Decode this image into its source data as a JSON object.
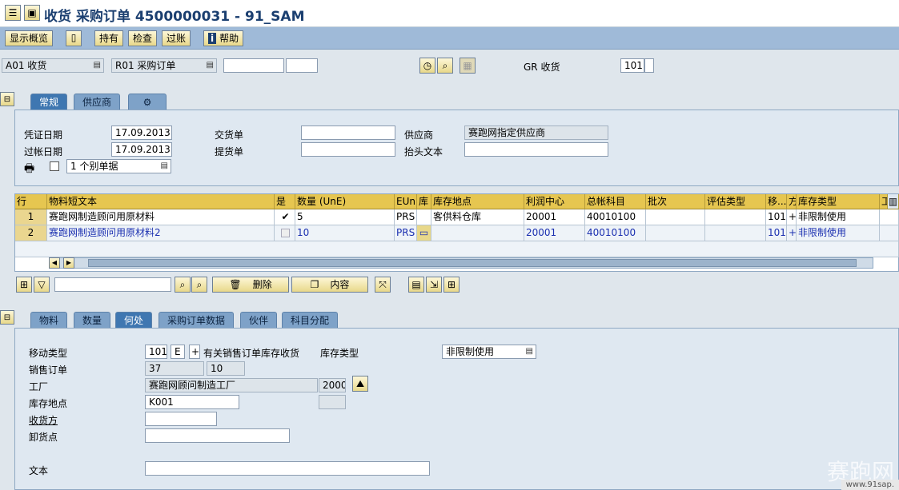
{
  "title": "收货 采购订单 4500000031 - 91_SAM",
  "toolbar": {
    "show_overview": "显示概览",
    "hold": "持有",
    "check": "检查",
    "post": "过账",
    "help": "帮助"
  },
  "header": {
    "action": "A01 收货",
    "reference": "R01 采购订单",
    "gr_label": "GR 收货",
    "movement_type": "101"
  },
  "tabs_top": [
    {
      "label": "常规",
      "active": true
    },
    {
      "label": "供应商",
      "active": false
    }
  ],
  "general": {
    "doc_date_label": "凭证日期",
    "doc_date": "17.09.2013",
    "post_date_label": "过帐日期",
    "post_date": "17.09.2013",
    "delivery_note_label": "交货单",
    "bill_of_lading_label": "提货单",
    "vendor_label": "供应商",
    "vendor": "赛跑网指定供应商",
    "header_text_label": "抬头文本",
    "slip_option": "1 个别单据"
  },
  "grid": {
    "headers": [
      "行",
      "物料短文本",
      "是",
      "数量 (UnE)",
      "EUn",
      "库",
      "库存地点",
      "利润中心",
      "总帐科目",
      "批次",
      "评估类型",
      "移...",
      "方",
      "库存类型",
      "工"
    ],
    "rows": [
      {
        "line": "1",
        "material": "赛跑网制造顾问用原材料",
        "ok": "✔",
        "qty": "5",
        "unit": "PRS",
        "sloc": "客供料仓库",
        "profit_center": "20001",
        "gl_account": "40010100",
        "mvt": "101",
        "sign": "+",
        "stock_type": "非限制使用"
      },
      {
        "line": "2",
        "material": "赛跑网制造顾问用原材料2",
        "ok": "",
        "qty": "10",
        "unit": "PRS",
        "sloc": "",
        "profit_center": "20001",
        "gl_account": "40010100",
        "mvt": "101",
        "sign": "+",
        "stock_type": "非限制使用"
      }
    ]
  },
  "grid_toolbar": {
    "delete": "删除",
    "content": "内容"
  },
  "tabs_bottom": [
    {
      "label": "物料",
      "active": false
    },
    {
      "label": "数量",
      "active": false
    },
    {
      "label": "何处",
      "active": true
    },
    {
      "label": "采购订单数据",
      "active": false
    },
    {
      "label": "伙伴",
      "active": false
    },
    {
      "label": "科目分配",
      "active": false
    }
  ],
  "where": {
    "movement_type_label": "移动类型",
    "movement_type": "101",
    "special_stock": "E",
    "sign": "+",
    "movement_text": "有关销售订单库存收货",
    "stock_type_label": "库存类型",
    "stock_type": "非限制使用",
    "sales_order_label": "销售订单",
    "sales_order": "37",
    "sales_order_item": "10",
    "plant_label": "工厂",
    "plant_name": "赛跑网顾问制造工厂",
    "plant_code": "2000",
    "sloc_label": "库存地点",
    "sloc": "K001",
    "recipient_label": "收货方",
    "unloading_label": "卸货点",
    "text_label": "文本"
  },
  "watermark": "赛跑网",
  "footer": "www.91sap."
}
